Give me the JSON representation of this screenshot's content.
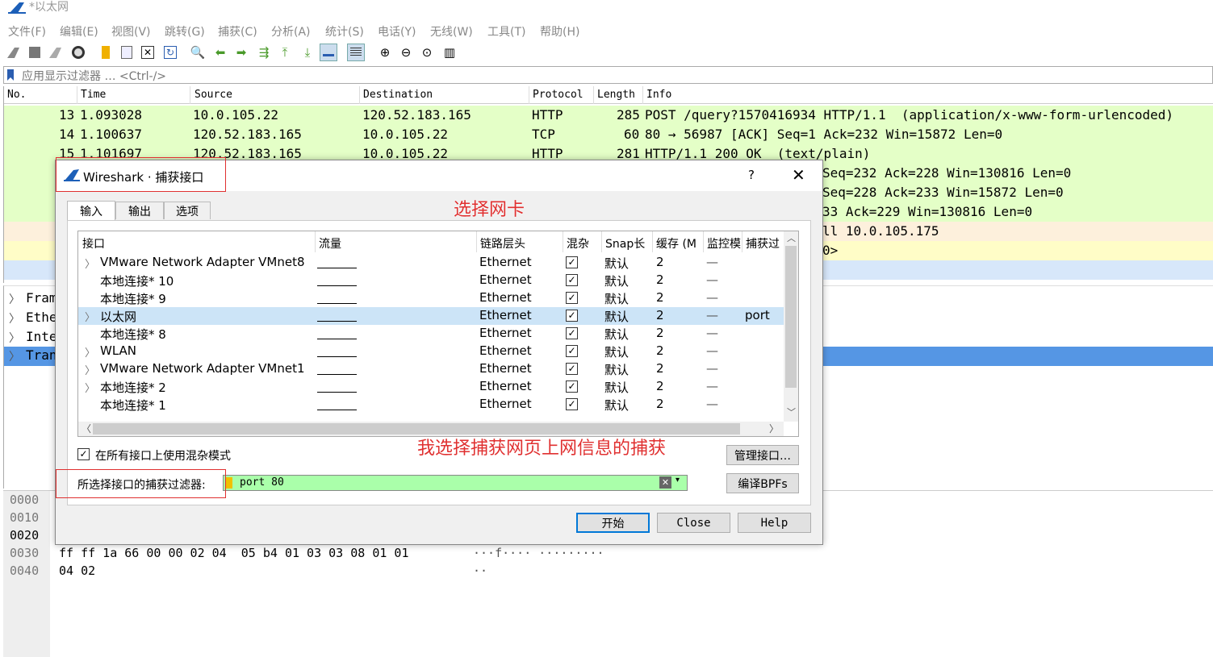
{
  "window": {
    "title": "*以太网"
  },
  "menu": [
    "文件(F)",
    "编辑(E)",
    "视图(V)",
    "跳转(G)",
    "捕获(C)",
    "分析(A)",
    "统计(S)",
    "电话(Y)",
    "无线(W)",
    "工具(T)",
    "帮助(H)"
  ],
  "filter": {
    "placeholder": "应用显示过滤器 … <Ctrl-/>"
  },
  "packet_list": {
    "columns": [
      "No.",
      "Time",
      "Source",
      "Destination",
      "Protocol",
      "Length",
      "Info"
    ],
    "rows": [
      {
        "no": "13",
        "time": "1.093028",
        "src": "10.0.105.22",
        "dst": "120.52.183.165",
        "proto": "HTTP",
        "len": "285",
        "info": "POST /query?1570416934 HTTP/1.1  (application/x-www-form-urlencoded)"
      },
      {
        "no": "14",
        "time": "1.100637",
        "src": "120.52.183.165",
        "dst": "10.0.105.22",
        "proto": "TCP",
        "len": "60",
        "info": "80 → 56987 [ACK] Seq=1 Ack=232 Win=15872 Len=0"
      },
      {
        "no": "15",
        "time": "1.101697",
        "src": "120.52.183.165",
        "dst": "10.0.105.22",
        "proto": "HTTP",
        "len": "281",
        "info": "HTTP/1.1 200 OK  (text/plain)"
      },
      {
        "info": "Seq=232 Ack=228 Win=130816 Len=0"
      },
      {
        "info": "Seq=228 Ack=233 Win=15872 Len=0"
      },
      {
        "info": "33 Ack=229 Win=130816 Len=0"
      },
      {
        "info": "ll 10.0.105.175"
      },
      {
        "info": "0>"
      }
    ]
  },
  "detail": [
    "Fram",
    "Ethe",
    "Inte",
    "Tran"
  ],
  "hex": [
    {
      "off": "0000",
      "hex": "",
      "ascii": ""
    },
    {
      "off": "0010",
      "hex": "",
      "ascii": ""
    },
    {
      "off": "0020",
      "hex": "",
      "ascii": ""
    },
    {
      "off": "0030",
      "hex": "ff ff 1a 66 00 00 02 04  05 b4 01 03 03 08 01 01",
      "ascii": "···f···· ·········"
    },
    {
      "off": "0040",
      "hex": "04 02",
      "ascii": "··"
    }
  ],
  "dialog": {
    "title": "Wireshark · 捕获接口",
    "help": "?",
    "tabs": [
      "输入",
      "输出",
      "选项"
    ],
    "columns": [
      "接口",
      "流量",
      "链路层头",
      "混杂",
      "Snap长",
      "缓存 (M",
      "监控模",
      "捕获过"
    ],
    "interfaces": [
      {
        "name": "VMware Network Adapter VMnet8",
        "expand": true,
        "link": "Ethernet",
        "promisc": true,
        "snap": "默认",
        "buf": "2",
        "mon": "—",
        "filter": ""
      },
      {
        "name": "本地连接* 10",
        "expand": false,
        "link": "Ethernet",
        "promisc": true,
        "snap": "默认",
        "buf": "2",
        "mon": "—",
        "filter": ""
      },
      {
        "name": "本地连接* 9",
        "expand": false,
        "link": "Ethernet",
        "promisc": true,
        "snap": "默认",
        "buf": "2",
        "mon": "—",
        "filter": ""
      },
      {
        "name": "以太网",
        "expand": true,
        "link": "Ethernet",
        "promisc": true,
        "snap": "默认",
        "buf": "2",
        "mon": "—",
        "filter": "port"
      },
      {
        "name": "本地连接* 8",
        "expand": false,
        "link": "Ethernet",
        "promisc": true,
        "snap": "默认",
        "buf": "2",
        "mon": "—",
        "filter": ""
      },
      {
        "name": "WLAN",
        "expand": true,
        "link": "Ethernet",
        "promisc": true,
        "snap": "默认",
        "buf": "2",
        "mon": "—",
        "filter": ""
      },
      {
        "name": "VMware Network Adapter VMnet1",
        "expand": true,
        "link": "Ethernet",
        "promisc": true,
        "snap": "默认",
        "buf": "2",
        "mon": "—",
        "filter": ""
      },
      {
        "name": "本地连接* 2",
        "expand": true,
        "link": "Ethernet",
        "promisc": true,
        "snap": "默认",
        "buf": "2",
        "mon": "—",
        "filter": ""
      },
      {
        "name": "本地连接* 1",
        "expand": false,
        "link": "Ethernet",
        "promisc": true,
        "snap": "默认",
        "buf": "2",
        "mon": "—",
        "filter": ""
      }
    ],
    "promisc_all_label": "在所有接口上使用混杂模式",
    "manage_button": "管理接口…",
    "filter_label": "所选择接口的捕获过滤器:",
    "filter_value": "port 80",
    "compile_button": "编译BPFs",
    "start_button": "开始",
    "close_button": "Close",
    "help_button": "Help"
  },
  "annotations": {
    "a1": "选择网卡",
    "a2": "我选择捕获网页上网信息的捕获"
  },
  "colors": {
    "row_green": "#e4ffc7",
    "row_yellow": "#fffdc7",
    "row_blue": "#d7e7fa",
    "selected_blue": "#5596e4",
    "filter_ok": "#aaffaa",
    "annotation_red": "#e03030"
  }
}
